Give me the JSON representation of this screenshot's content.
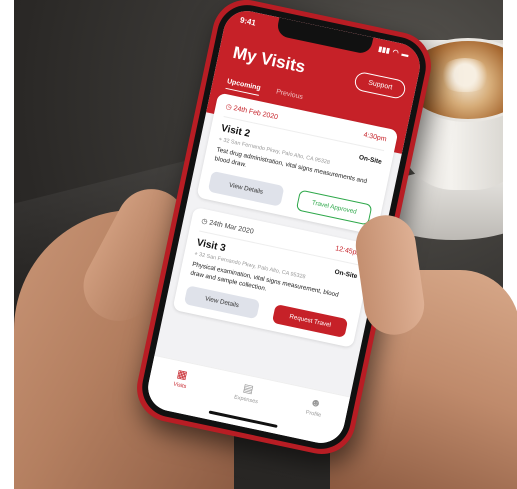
{
  "status": {
    "time": "9:41",
    "signal": "▮▮▮",
    "wifi": "◠",
    "battery": "▬"
  },
  "header": {
    "title": "My Visits",
    "support_label": "Support"
  },
  "tabs": [
    {
      "label": "Upcoming"
    },
    {
      "label": "Previous"
    }
  ],
  "visits": [
    {
      "date": "24th Feb 2020",
      "time": "4:30pm",
      "name": "Visit 2",
      "type": "On-Site",
      "address": "32 San Fernando Pkwy, Palo Alto, CA 95328",
      "description": "Test drug administration, vital signs measurements and blood draw.",
      "primary_action": "View Details",
      "secondary_action": "Travel Approved"
    },
    {
      "date": "24th Mar 2020",
      "time": "12:45pm",
      "name": "Visit 3",
      "type": "On-Site",
      "address": "32 San Fernando Pkwy, Palo Alto, CA 95328",
      "description": "Physical examination, vital signs measurement, blood draw and sample collection.",
      "primary_action": "View Details",
      "secondary_action": "Request Travel"
    }
  ],
  "nav": [
    {
      "label": "Visits",
      "icon": "calendar-icon",
      "glyph": "▦"
    },
    {
      "label": "Expenses",
      "icon": "receipt-icon",
      "glyph": "▤"
    },
    {
      "label": "Profile",
      "icon": "user-icon",
      "glyph": "☻"
    }
  ],
  "colors": {
    "brand_red": "#c62128",
    "approved_green": "#2ea84a"
  }
}
